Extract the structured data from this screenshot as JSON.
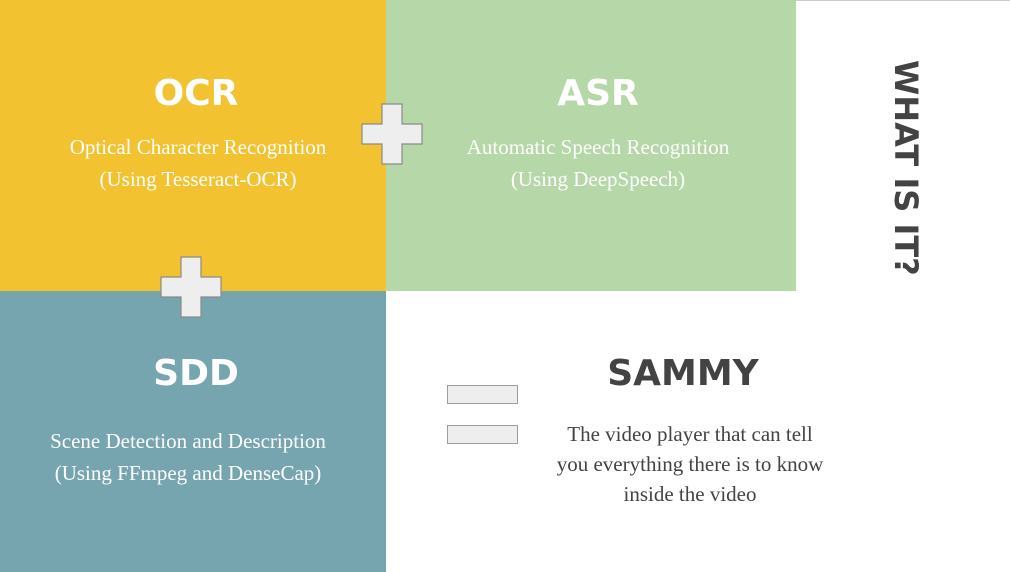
{
  "ocr": {
    "title": "OCR",
    "desc_line1": "Optical Character Recognition",
    "desc_line2": "(Using Tesseract-OCR)"
  },
  "asr": {
    "title": "ASR",
    "desc_line1": "Automatic Speech Recognition",
    "desc_line2": "(Using DeepSpeech)"
  },
  "sdd": {
    "title": "SDD",
    "desc_line1": "Scene Detection and Description",
    "desc_line2": "(Using FFmpeg and DenseCap)"
  },
  "sammy": {
    "title": "SAMMY",
    "desc_line1": "The video player that can tell",
    "desc_line2": "you everything there is to know",
    "desc_line3": "inside the video"
  },
  "side_label": "WHAT IS IT?",
  "icons": {
    "plus": "plus-icon",
    "equals": "equals-icon"
  },
  "colors": {
    "ocr_panel": "#f2c230",
    "asr_panel": "#b6d7a8",
    "sdd_panel": "#76a5af",
    "dark_text": "#434343"
  }
}
